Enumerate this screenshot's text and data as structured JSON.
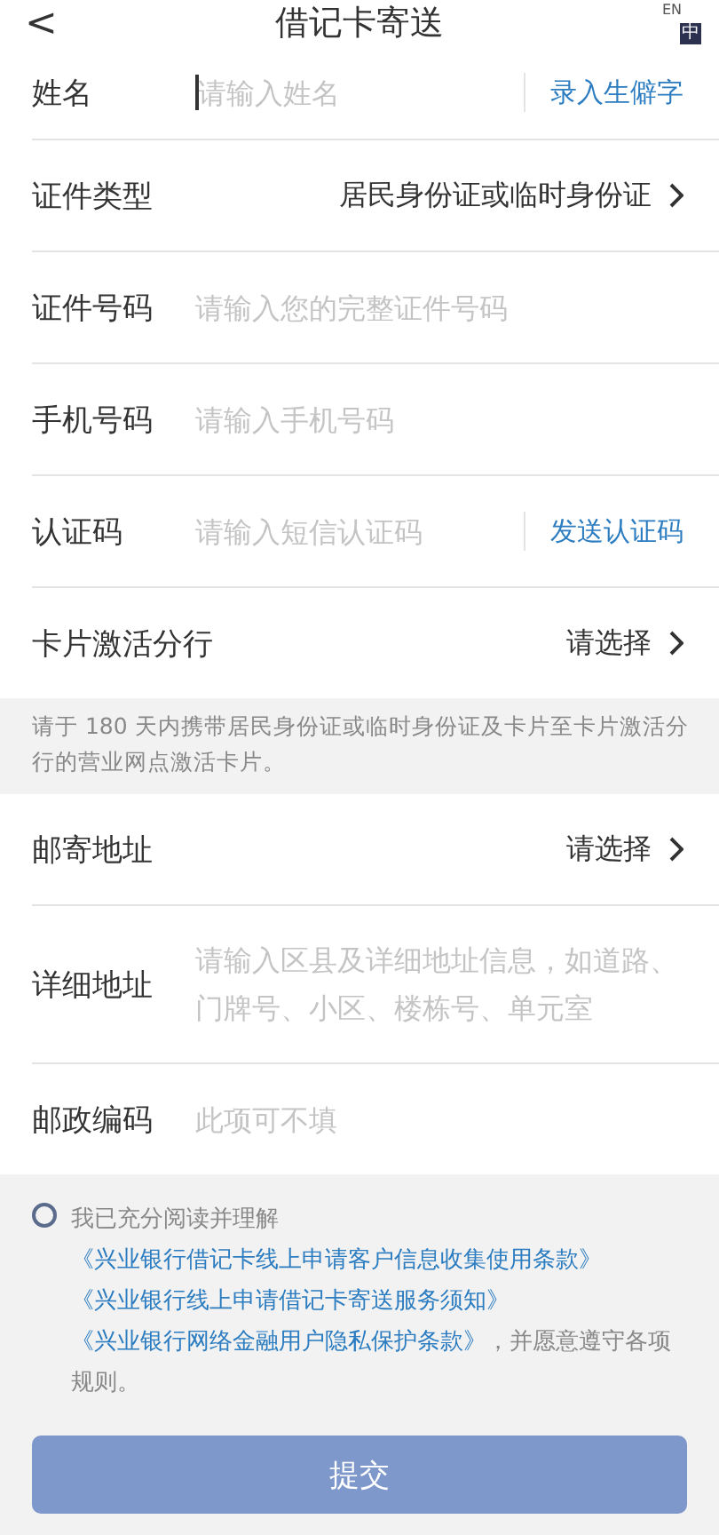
{
  "header": {
    "back": "<",
    "title": "借记卡寄送",
    "language_toggle": {
      "primary": "EN",
      "secondary": "中"
    }
  },
  "fields_top": [
    {
      "kind": "input",
      "label": "姓名",
      "placeholder": "请输入姓名",
      "focused": true,
      "action": "录入生僻字"
    },
    {
      "kind": "select",
      "label": "证件类型",
      "value": "居民身份证或临时身份证"
    },
    {
      "kind": "input",
      "label": "证件号码",
      "placeholder": "请输入您的完整证件号码",
      "focused": false
    },
    {
      "kind": "input",
      "label": "手机号码",
      "placeholder": "请输入手机号码",
      "focused": false
    },
    {
      "kind": "input",
      "label": "认证码",
      "placeholder": "请输入短信认证码",
      "focused": false,
      "action": "发送认证码"
    },
    {
      "kind": "select",
      "label": "卡片激活分行",
      "value": "请选择"
    }
  ],
  "notice": "请于 180 天内携带居民身份证或临时身份证及卡片至卡片激活分行的营业网点激活卡片。",
  "fields_bottom": [
    {
      "kind": "select",
      "label": "邮寄地址",
      "value": "请选择"
    },
    {
      "kind": "textarea",
      "label": "详细地址",
      "placeholder": "请输入区县及详细地址信息，如道路、门牌号、小区、楼栋号、单元室"
    },
    {
      "kind": "input",
      "label": "邮政编码",
      "placeholder": "此项可不填",
      "focused": false
    }
  ],
  "agreement": {
    "checked": false,
    "parts": [
      {
        "kind": "text",
        "text": "我已充分阅读并理解"
      },
      {
        "kind": "link",
        "text": "《兴业银行借记卡线上申请客户信息收集使用条款》"
      },
      {
        "kind": "link",
        "text": "《兴业银行线上申请借记卡寄送服务须知》"
      },
      {
        "kind": "link",
        "text": "《兴业银行网络金融用户隐私保护条款》"
      },
      {
        "kind": "text",
        "text": "，并愿意遵守各项规则。"
      }
    ]
  },
  "submit": {
    "label": "提交",
    "disabled": true
  }
}
